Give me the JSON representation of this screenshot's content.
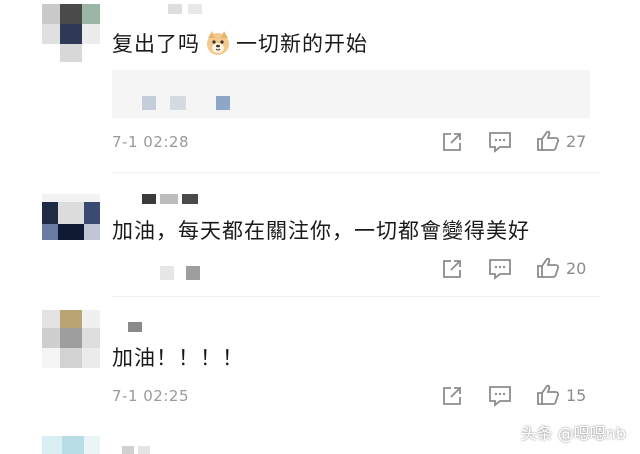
{
  "comments": [
    {
      "text_before_emoji": "复出了吗",
      "emoji": "dog-face-emoji",
      "text_after_emoji": "一切新的开始",
      "timestamp": "7-1 02:28",
      "likes": "27",
      "has_quoted_block": true
    },
    {
      "text": "加油，每天都在關注你，一切都會變得美好",
      "timestamp": "",
      "likes": "20",
      "has_quoted_block": false
    },
    {
      "text": "加油！！！！",
      "timestamp": "7-1 02:25",
      "likes": "15",
      "has_quoted_block": false
    }
  ],
  "actions": {
    "share_icon": "share-external-icon",
    "reply_icon": "comment-bubble-icon",
    "like_icon": "thumbs-up-icon"
  },
  "colors": {
    "icon_gray": "#8c8c8c",
    "timestamp_gray": "#9a9a9a",
    "quoted_bg": "#f5f5f5"
  },
  "watermark": "头条 @嗯嗯nb"
}
